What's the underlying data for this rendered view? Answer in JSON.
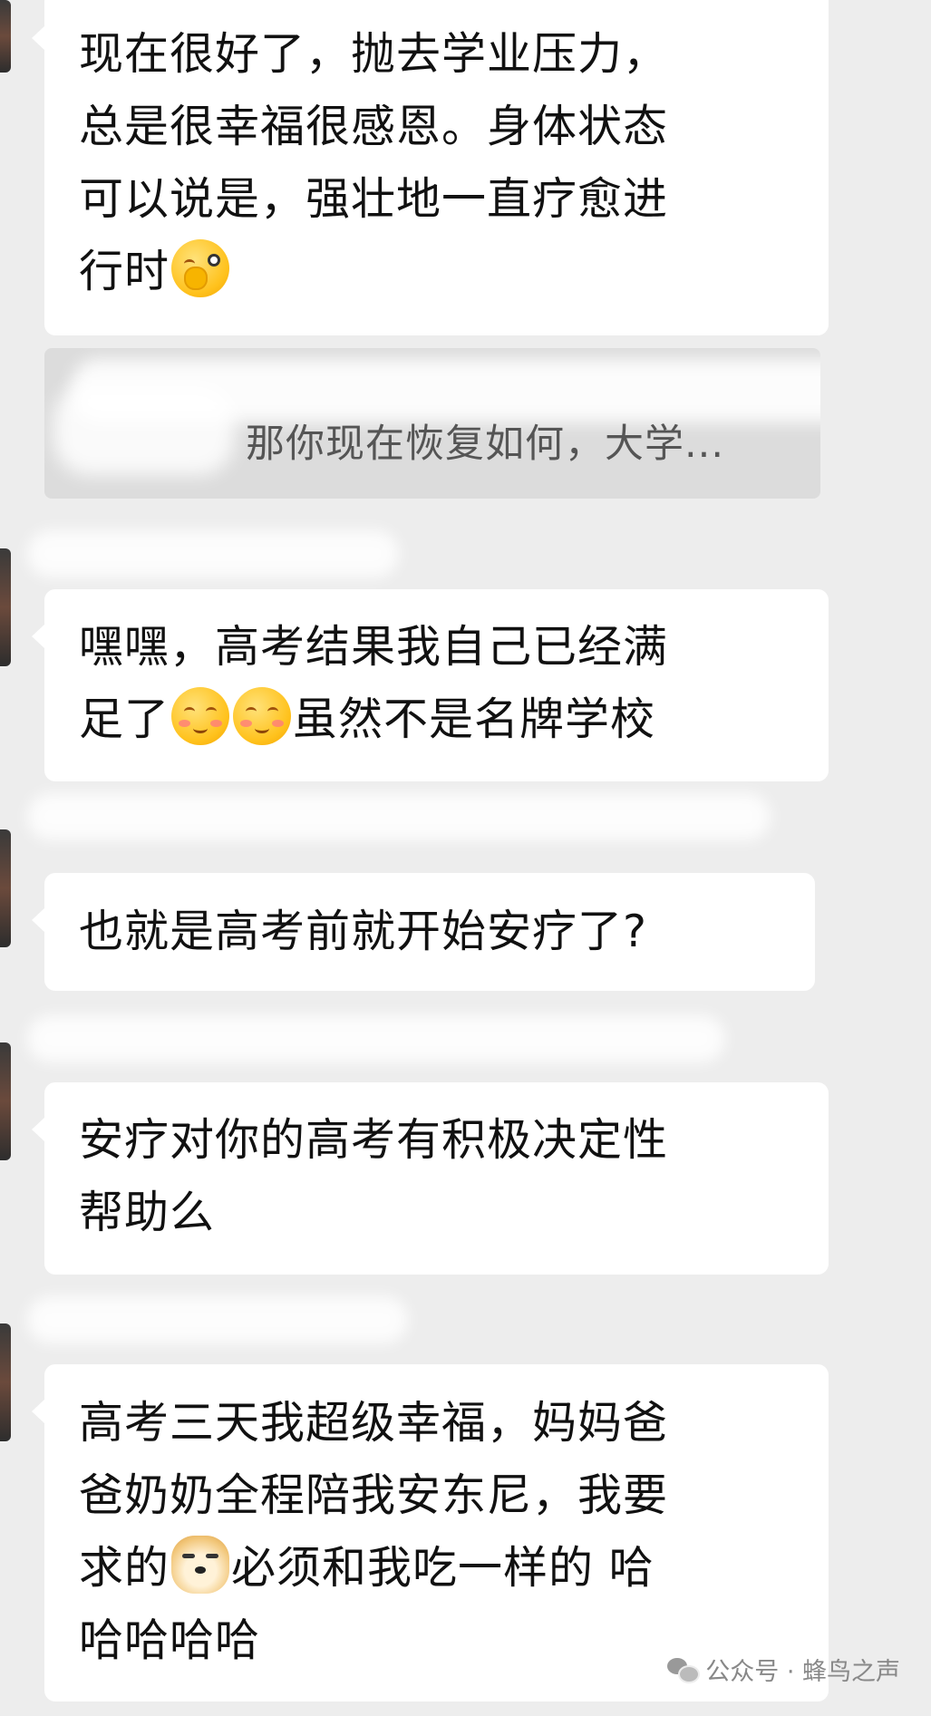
{
  "messages": [
    {
      "lines": [
        "现在很好了，抛去学业压力，",
        "总是很幸福很感恩。身体状态",
        "可以说是，强壮地一直疗愈进",
        "行时"
      ],
      "emoji": "wink-face-emoji"
    },
    {
      "quote": "那你现在恢复如何，大学..."
    },
    {
      "lines": [
        "嘿嘿，高考结果我自己已经满",
        "足了",
        "虽然不是名牌学校"
      ],
      "emoji": "shy-smile-emoji"
    },
    {
      "lines": [
        "也就是高考前就开始安疗了?"
      ]
    },
    {
      "lines": [
        "安疗对你的高考有积极决定性",
        "帮助么"
      ]
    },
    {
      "lines": [
        "高考三天我超级幸福，妈妈爸",
        "爸奶奶全程陪我安东尼，我要",
        "求的",
        "必须和我吃一样的 哈",
        "哈哈哈哈"
      ],
      "emoji": "doge-emoji"
    }
  ],
  "watermark": "公众号 · 蜂鸟之声",
  "colors": {
    "background": "#ededed",
    "bubble": "#ffffff",
    "quote_bg": "#dcdcdc"
  }
}
